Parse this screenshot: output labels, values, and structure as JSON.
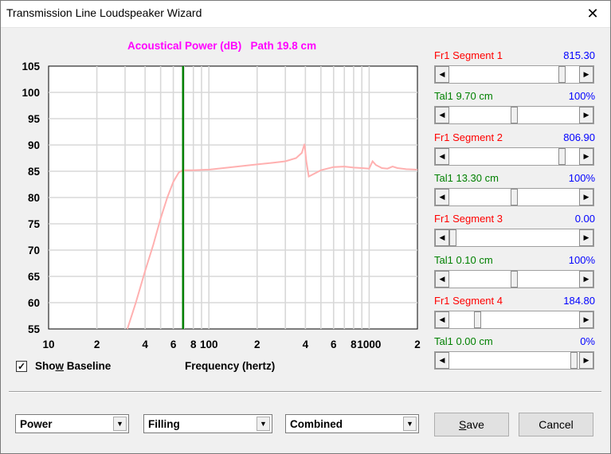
{
  "window": {
    "title": "Transmission Line Loudspeaker Wizard",
    "close_glyph": "✕"
  },
  "chart_title": "Acoustical Power (dB)   Path 19.8 cm",
  "chart_data": {
    "type": "line",
    "title": "Acoustical Power (dB)   Path 19.8 cm",
    "xlabel": "Frequency (hertz)",
    "ylabel": "",
    "x_scale": "log",
    "xlim": [
      10,
      2000
    ],
    "ylim": [
      55,
      105
    ],
    "y_ticks": [
      "105",
      "100",
      "95",
      "90",
      "85",
      "80",
      "75",
      "70",
      "65",
      "60",
      "55"
    ],
    "x_ticks": [
      {
        "value": 10,
        "label": "10"
      },
      {
        "value": 20,
        "label": "2"
      },
      {
        "value": 40,
        "label": "4"
      },
      {
        "value": 60,
        "label": "6"
      },
      {
        "value": 80,
        "label": "8"
      },
      {
        "value": 100,
        "label": "100"
      },
      {
        "value": 200,
        "label": "2"
      },
      {
        "value": 400,
        "label": "4"
      },
      {
        "value": 600,
        "label": "6"
      },
      {
        "value": 800,
        "label": "8"
      },
      {
        "value": 1000,
        "label": "1000"
      },
      {
        "value": 2000,
        "label": "2"
      }
    ],
    "marker_frequency": 69,
    "grid": true,
    "series": [
      {
        "color": "#ffb0b0",
        "x": [
          31,
          35,
          40,
          45,
          50,
          55,
          60,
          65,
          69,
          80,
          100,
          150,
          200,
          250,
          300,
          350,
          380,
          395,
          405,
          420,
          500,
          600,
          700,
          800,
          900,
          1000,
          1050,
          1100,
          1200,
          1300,
          1400,
          1500,
          1700,
          2000
        ],
        "y": [
          55,
          60,
          66,
          71,
          76,
          80,
          83,
          84.8,
          85.2,
          85.2,
          85.3,
          85.9,
          86.3,
          86.6,
          86.9,
          87.5,
          88.5,
          90.2,
          87,
          84,
          85.2,
          85.8,
          85.9,
          85.7,
          85.6,
          85.5,
          86.9,
          86.2,
          85.6,
          85.5,
          85.9,
          85.6,
          85.4,
          85.3
        ]
      }
    ],
    "marker_color": "#008000"
  },
  "baseline": {
    "label_pre": "Sho",
    "label_u": "w",
    "label_post": " Baseline",
    "checked_glyph": "✓"
  },
  "controls": [
    {
      "kind": "segment",
      "label": "Fr1  Segment 1",
      "value": "815.30",
      "thumb_frac": 0.887
    },
    {
      "kind": "tal",
      "label": "Tal1  9.70 cm",
      "value": "100%",
      "thumb_frac": 0.5
    },
    {
      "kind": "segment",
      "label": "Fr1  Segment 2",
      "value": "806.90",
      "thumb_frac": 0.887
    },
    {
      "kind": "tal",
      "label": "Tal1  13.30 cm",
      "value": "100%",
      "thumb_frac": 0.5
    },
    {
      "kind": "segment",
      "label": "Fr1  Segment 3",
      "value": "0.00",
      "thumb_frac": 0.0
    },
    {
      "kind": "tal",
      "label": "Tal1  0.10 cm",
      "value": "100%",
      "thumb_frac": 0.5
    },
    {
      "kind": "segment",
      "label": "Fr1  Segment 4",
      "value": "184.80",
      "thumb_frac": 0.2
    },
    {
      "kind": "tal",
      "label": "Tal1  0.00 cm",
      "value": "0%",
      "thumb_frac": 0.984
    }
  ],
  "dropdowns": {
    "mode": "Power",
    "filling": "Filling",
    "combined": "Combined",
    "arrow": "▼"
  },
  "buttons": {
    "save_pre": "",
    "save_u": "S",
    "save_post": "ave",
    "cancel": "Cancel"
  },
  "arrows": {
    "left": "◀",
    "right": "▶"
  },
  "colors": {
    "curve": "#ffb0b0",
    "marker": "#008000",
    "segment_label": "#ff0000",
    "tal_label": "#008000",
    "value": "#0000ff",
    "title": "#ff00ff"
  }
}
